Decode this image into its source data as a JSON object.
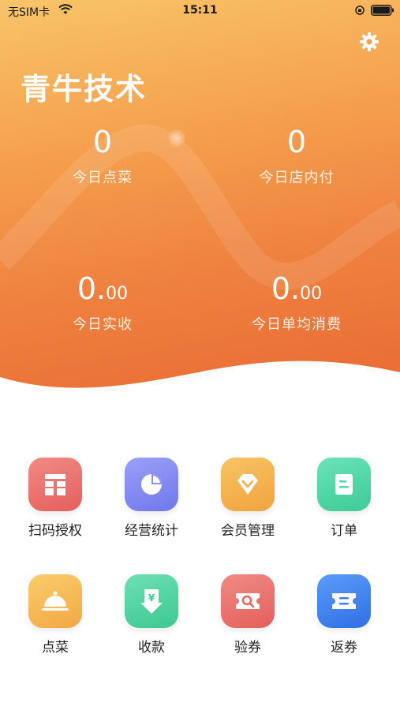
{
  "status_bar": {
    "carrier": "无SIM卡",
    "time": "15:11"
  },
  "header": {
    "title": "青牛技术"
  },
  "stats": [
    {
      "value_int": "0",
      "value_dec": "",
      "label": "今日点菜"
    },
    {
      "value_int": "0",
      "value_dec": "",
      "label": "今日店内付"
    },
    {
      "value_int": "0.",
      "value_dec": "00",
      "label": "今日实收"
    },
    {
      "value_int": "0.",
      "value_dec": "00",
      "label": "今日单均消费"
    }
  ],
  "menu": [
    {
      "label": "扫码授权",
      "icon": "scan-auth-icon",
      "color": "#ec6f6b"
    },
    {
      "label": "经营统计",
      "icon": "pie-chart-icon",
      "color": "#7c86f2"
    },
    {
      "label": "会员管理",
      "icon": "diamond-icon",
      "color": "#f2b24e"
    },
    {
      "label": "订单",
      "icon": "order-list-icon",
      "color": "#4fd6a5"
    },
    {
      "label": "点菜",
      "icon": "food-cloche-icon",
      "color": "#f5b84e"
    },
    {
      "label": "收款",
      "icon": "payment-download-icon",
      "color": "#50d2a0"
    },
    {
      "label": "验券",
      "icon": "ticket-search-icon",
      "color": "#ec6f6b"
    },
    {
      "label": "返券",
      "icon": "coupon-icon",
      "color": "#3f86ef"
    }
  ],
  "colors": {
    "hero_top": "#f8c468",
    "hero_bottom": "#e96a33"
  }
}
